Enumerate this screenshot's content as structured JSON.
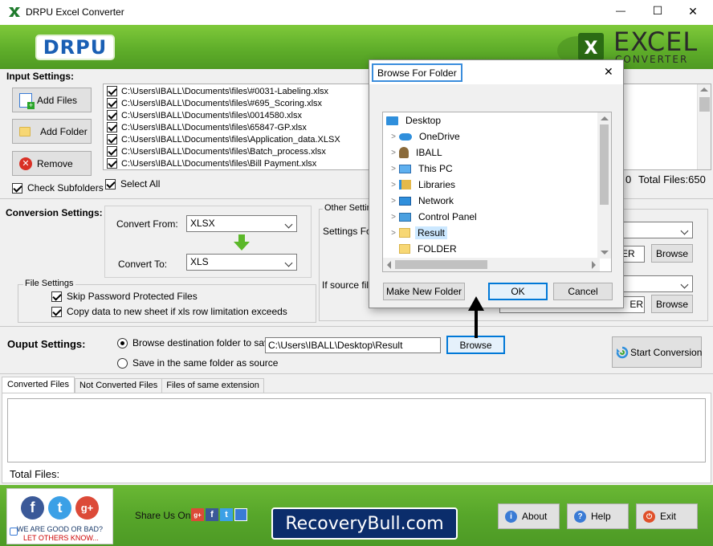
{
  "window": {
    "title": "DRPU Excel Converter",
    "minimize": "—",
    "maximize": "☐",
    "close": "✕"
  },
  "banner": {
    "brand": "DRPU",
    "product_line1": "EXCEL",
    "product_line2": "CONVERTER",
    "logo_letter": "X"
  },
  "input_settings": {
    "title": "Input Settings:",
    "add_files": "Add Files",
    "add_folder": "Add Folder",
    "remove": "Remove",
    "check_subfolders": "Check Subfolders",
    "select_all": "Select All",
    "total_files": "Total Files:650",
    "total_count_partial": "0",
    "files": [
      "C:\\Users\\IBALL\\Documents\\files\\#0031-Labeling.xlsx",
      "C:\\Users\\IBALL\\Documents\\files\\#695_Scoring.xlsx",
      "C:\\Users\\IBALL\\Documents\\files\\0014580.xlsx",
      "C:\\Users\\IBALL\\Documents\\files\\65847-GP.xlsx",
      "C:\\Users\\IBALL\\Documents\\files\\Application_data.XLSX",
      "C:\\Users\\IBALL\\Documents\\files\\Batch_process.xlsx",
      "C:\\Users\\IBALL\\Documents\\files\\Bill Payment.xlsx"
    ]
  },
  "conversion_settings": {
    "title": "Conversion Settings:",
    "convert_from_label": "Convert From:",
    "convert_from_value": "XLSX",
    "convert_to_label": "Convert To:",
    "convert_to_value": "XLS",
    "file_settings_title": "File Settings",
    "skip_password": "Skip Password Protected Files",
    "copy_data": "Copy data to new sheet if xls row limitation exceeds",
    "other_settings_title": "Other Settin",
    "settings_label": "Settings Fo",
    "if_source_label": "If source fil",
    "browse1": "Browse",
    "browse2": "Browse",
    "er1": "ER",
    "er2": "ER"
  },
  "output_settings": {
    "title": "Ouput Settings:",
    "radio_browse": "Browse destination folder to save",
    "radio_same": "Save in the same folder as source",
    "path": "C:\\Users\\IBALL\\Desktop\\Result",
    "browse": "Browse",
    "start": "Start Conversion"
  },
  "tabs": [
    {
      "label": "Converted Files"
    },
    {
      "label": "Not Converted Files"
    },
    {
      "label": "Files of same extension"
    }
  ],
  "results": {
    "total_files": "Total Files:"
  },
  "footer": {
    "rate_line1": "WE ARE GOOD OR BAD?",
    "rate_line2": "LET OTHERS KNOW...",
    "share_label": "Share Us On:",
    "recoverybull": "RecoveryBull.com",
    "about": "About",
    "help": "Help",
    "exit": "Exit",
    "social": {
      "facebook": "f",
      "twitter": "t",
      "google": "g+"
    }
  },
  "dialog": {
    "title": "Browse For Folder",
    "close": "✕",
    "tree": [
      {
        "label": "Desktop",
        "icon": "desktop-icon",
        "expander": "",
        "selected": false
      },
      {
        "label": "OneDrive",
        "icon": "cloud-icon",
        "expander": ">",
        "selected": false
      },
      {
        "label": "IBALL",
        "icon": "user-icon",
        "expander": ">",
        "selected": false
      },
      {
        "label": "This PC",
        "icon": "pc-icon",
        "expander": ">",
        "selected": false
      },
      {
        "label": "Libraries",
        "icon": "library-icon",
        "expander": ">",
        "selected": false
      },
      {
        "label": "Network",
        "icon": "network-icon",
        "expander": ">",
        "selected": false
      },
      {
        "label": "Control Panel",
        "icon": "control-panel-icon",
        "expander": ">",
        "selected": false
      },
      {
        "label": "Result",
        "icon": "folder-icon",
        "expander": ">",
        "selected": true
      },
      {
        "label": "FOLDER",
        "icon": "folder-icon",
        "expander": "",
        "selected": false
      }
    ],
    "make_new_folder": "Make New Folder",
    "ok": "OK",
    "cancel": "Cancel"
  },
  "colors": {
    "banner_green": "#6dbb2e",
    "footer_green": "#5aa829",
    "drpu_blue": "#1a5fb4",
    "highlight_blue": "#cce8ff",
    "focus_blue": "#0078d7"
  }
}
